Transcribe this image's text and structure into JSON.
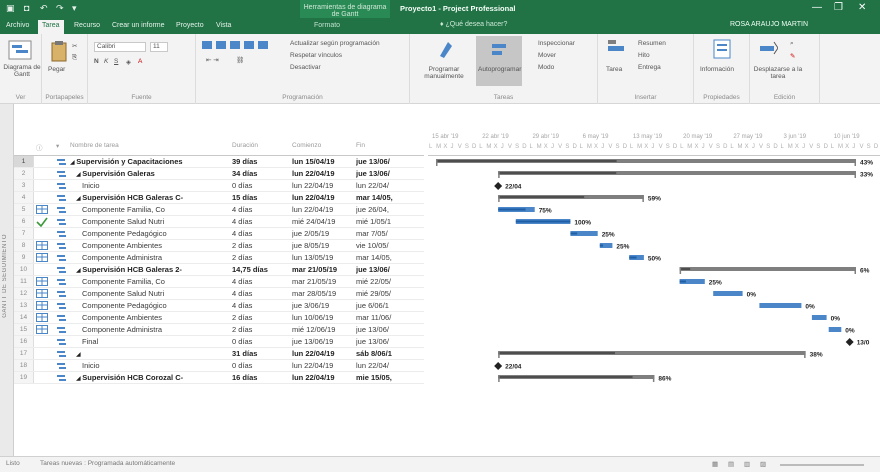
{
  "titlebar": {
    "context_group": "Herramientas de diagrama de Gantt",
    "document_title": "Proyecto1 - Project Professional"
  },
  "tabs": [
    {
      "label": "Archivo"
    },
    {
      "label": "Tarea"
    },
    {
      "label": "Recurso"
    },
    {
      "label": "Crear un informe"
    },
    {
      "label": "Proyecto"
    },
    {
      "label": "Vista"
    },
    {
      "label": "Formato"
    }
  ],
  "tellme": "¿Qué desea hacer?",
  "user_name": "ROSA ARAUJO MARTIN",
  "ribbon": {
    "groups": [
      {
        "label": "Ver"
      },
      {
        "label": "Portapapeles"
      },
      {
        "label": "Fuente"
      },
      {
        "label": "Programación"
      },
      {
        "label": "Tareas"
      },
      {
        "label": "Insertar"
      },
      {
        "label": "Propiedades"
      },
      {
        "label": "Edición"
      }
    ],
    "view_button": "Diagrama de Gantt",
    "paste_button": "Pegar",
    "font_name": "Calibri",
    "font_size": "11",
    "schedule_items": [
      "Actualizar según programación",
      "Respetar vínculos",
      "Desactivar"
    ],
    "tasks_buttons": [
      "Programar manualmente",
      "Autoprogramar"
    ],
    "tasks_items": [
      "Inspeccionar",
      "Mover",
      "Modo"
    ],
    "insert_buttons": [
      "Tarea"
    ],
    "insert_items": [
      "Resumen",
      "Hito",
      "Entrega"
    ],
    "properties_button": "Información",
    "edit_button": "Desplazarse a la tarea"
  },
  "sidebar_label": "GANTT DE SEGUIMIENTO",
  "table": {
    "headers": {
      "name": "Nombre de tarea",
      "duration": "Duración",
      "start": "Comienzo",
      "finish": "Fin"
    },
    "rows": [
      {
        "num": "1",
        "name": "Supervisión y Capacitaciones",
        "duration": "39 días",
        "start": "lun 15/04/19",
        "finish": "jue 13/06/",
        "summary": true,
        "indent": 0,
        "bar": {
          "type": "summary",
          "start": 0,
          "end": 1.0,
          "progress": 0.43
        },
        "pct": "43%",
        "icons": ""
      },
      {
        "num": "2",
        "name": "Supervisión Galeras",
        "duration": "34 días",
        "start": "lun 22/04/19",
        "finish": "jue 13/06/",
        "summary": true,
        "indent": 1,
        "bar": {
          "type": "summary",
          "start": 0.148,
          "end": 1.0,
          "progress": 0.33
        },
        "pct": "33%",
        "icons": ""
      },
      {
        "num": "3",
        "name": "Inicio",
        "duration": "0 días",
        "start": "lun 22/04/19",
        "finish": "lun 22/04/",
        "summary": false,
        "indent": 2,
        "bar": {
          "type": "milestone",
          "start": 0.148
        },
        "pct": "22/04",
        "icons": ""
      },
      {
        "num": "4",
        "name": "Supervisión HCB Galeras C-",
        "duration": "15 días",
        "start": "lun 22/04/19",
        "finish": "mar 14/05,",
        "summary": true,
        "indent": 1,
        "bar": {
          "type": "summary",
          "start": 0.148,
          "end": 0.495,
          "progress": 0.59
        },
        "pct": "59%",
        "icons": ""
      },
      {
        "num": "5",
        "name": "Componente Familia, Co",
        "duration": "4 días",
        "start": "lun 22/04/19",
        "finish": "jue 26/04,",
        "summary": false,
        "indent": 2,
        "bar": {
          "type": "task",
          "start": 0.148,
          "end": 0.235,
          "progress": 0.75
        },
        "pct": "75%",
        "icons": "table"
      },
      {
        "num": "6",
        "name": "Componente Salud Nutri",
        "duration": "4 días",
        "start": "mié 24/04/19",
        "finish": "mié 1/05/1",
        "summary": false,
        "indent": 2,
        "bar": {
          "type": "task",
          "start": 0.19,
          "end": 0.32,
          "progress": 1.0
        },
        "pct": "100%",
        "icons": "check"
      },
      {
        "num": "7",
        "name": "Componente Pedagógico",
        "duration": "4 días",
        "start": "jue 2/05/19",
        "finish": "mar 7/05/",
        "summary": false,
        "indent": 2,
        "bar": {
          "type": "task",
          "start": 0.32,
          "end": 0.385,
          "progress": 0.25
        },
        "pct": "25%",
        "icons": ""
      },
      {
        "num": "8",
        "name": "Componente Ambientes",
        "duration": "2 días",
        "start": "jue 8/05/19",
        "finish": "vie 10/05/",
        "summary": false,
        "indent": 2,
        "bar": {
          "type": "task",
          "start": 0.39,
          "end": 0.42,
          "progress": 0.25
        },
        "pct": "25%",
        "icons": "table"
      },
      {
        "num": "9",
        "name": "Componente Administra",
        "duration": "2 días",
        "start": "lun 13/05/19",
        "finish": "mar 14/05,",
        "summary": false,
        "indent": 2,
        "bar": {
          "type": "task",
          "start": 0.46,
          "end": 0.495,
          "progress": 0.5
        },
        "pct": "50%",
        "icons": "table"
      },
      {
        "num": "10",
        "name": "Supervisión HCB Galeras 2-",
        "duration": "14,75 días",
        "start": "mar 21/05/19",
        "finish": "jue 13/06/",
        "summary": true,
        "indent": 1,
        "bar": {
          "type": "summary",
          "start": 0.58,
          "end": 1.0,
          "progress": 0.06
        },
        "pct": "6%",
        "icons": ""
      },
      {
        "num": "11",
        "name": "Componente Familia, Co",
        "duration": "4 días",
        "start": "mar 21/05/19",
        "finish": "mié 22/05/",
        "summary": false,
        "indent": 2,
        "bar": {
          "type": "task",
          "start": 0.58,
          "end": 0.64,
          "progress": 0.25
        },
        "pct": "25%",
        "icons": "table"
      },
      {
        "num": "12",
        "name": "Componente Salud Nutri",
        "duration": "4 días",
        "start": "mar 28/05/19",
        "finish": "mié 29/05/",
        "summary": false,
        "indent": 2,
        "bar": {
          "type": "task",
          "start": 0.66,
          "end": 0.73,
          "progress": 0.0
        },
        "pct": "0%",
        "icons": "table"
      },
      {
        "num": "13",
        "name": "Componente Pedagógico",
        "duration": "4 días",
        "start": "jue 3/06/19",
        "finish": "jue 6/06/1",
        "summary": false,
        "indent": 2,
        "bar": {
          "type": "task",
          "start": 0.77,
          "end": 0.87,
          "progress": 0.0
        },
        "pct": "0%",
        "icons": "table"
      },
      {
        "num": "14",
        "name": "Componente Ambientes",
        "duration": "2 días",
        "start": "lun 10/06/19",
        "finish": "mar 11/06/",
        "summary": false,
        "indent": 2,
        "bar": {
          "type": "task",
          "start": 0.895,
          "end": 0.93,
          "progress": 0.0
        },
        "pct": "0%",
        "icons": "table"
      },
      {
        "num": "15",
        "name": "Componente Administra",
        "duration": "2 días",
        "start": "mié 12/06/19",
        "finish": "jue 13/06/",
        "summary": false,
        "indent": 2,
        "bar": {
          "type": "task",
          "start": 0.935,
          "end": 0.965,
          "progress": 0.0
        },
        "pct": "0%",
        "icons": "table"
      },
      {
        "num": "16",
        "name": "Final",
        "duration": "0 días",
        "start": "jue 13/06/19",
        "finish": "jue 13/06/",
        "summary": false,
        "indent": 2,
        "bar": {
          "type": "milestone",
          "start": 0.985
        },
        "pct": "13/0",
        "icons": ""
      },
      {
        "num": "17",
        "name": "",
        "duration": "31 días",
        "start": "lun 22/04/19",
        "finish": "sáb 8/06/1",
        "summary": true,
        "indent": 1,
        "bar": {
          "type": "summary",
          "start": 0.148,
          "end": 0.88,
          "progress": 0.38
        },
        "pct": "38%",
        "icons": ""
      },
      {
        "num": "18",
        "name": "Inicio",
        "duration": "0 días",
        "start": "lun 22/04/19",
        "finish": "lun 22/04/",
        "summary": false,
        "indent": 2,
        "bar": {
          "type": "milestone",
          "start": 0.148
        },
        "pct": "22/04",
        "icons": ""
      },
      {
        "num": "19",
        "name": "Supervisión HCB Corozal C-",
        "duration": "16 días",
        "start": "lun 22/04/19",
        "finish": "mie 15/05,",
        "summary": true,
        "indent": 1,
        "bar": {
          "type": "summary",
          "start": 0.148,
          "end": 0.52,
          "progress": 0.86
        },
        "pct": "86%",
        "icons": ""
      }
    ]
  },
  "gantt": {
    "weeks": [
      "15 abr '19",
      "22 abr '19",
      "29 abr '19",
      "6 may '19",
      "13 may '19",
      "20 may '19",
      "27 may '19",
      "3 jun '19",
      "10 jun '19"
    ],
    "days": [
      "L",
      "M",
      "X",
      "J",
      "V",
      "S",
      "D"
    ],
    "colors": {
      "task": "#4a86c8",
      "progress": "#1e5fa8",
      "summary": "#7f7f7f",
      "summary_progress": "#4d4d4d",
      "milestone": "#222222"
    }
  },
  "status": {
    "ready": "Listo",
    "new_tasks": "Tareas nuevas : Programada automáticamente"
  }
}
